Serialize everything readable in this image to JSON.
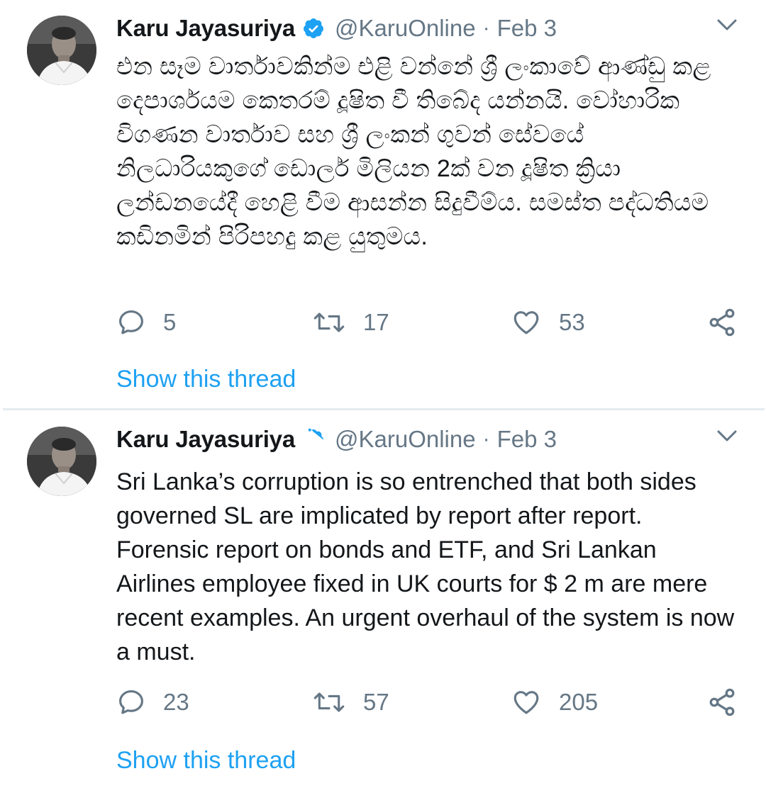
{
  "colors": {
    "accent": "#1da1f2",
    "secondary_text": "#657786",
    "primary_text": "#14171a",
    "divider": "#e6ecf0"
  },
  "tweets": [
    {
      "author_name": "Karu Jayasuriya",
      "verified_icon": "verified-badge-icon",
      "handle": "@KaruOnline",
      "separator": "·",
      "date": "Feb 3",
      "text": "එන සෑම වාර්තාවකින්ම එළි වන්නේ ශ්‍රී ලංකාවේ ආණ්ඩු කළ දෙපාර්ශයම කෙතරම් දූෂිත වී තිබේද යන්නයි. ‍වෝහාරික විගණන වාර්තාව සහ ශ්‍රී ලංකන් ගුවන් සේවයේ නිලධාරියකුගේ ඩොලර් මිලියන 2ක් වන දූෂිත ක්‍රියා ලන්ඩනයේදී හෙළි වීම ආසන්න සිදුවීම්ය. සමස්ත පද්ධතියම කඩිනමින් පිරිපහදු කළ යුතුමය.",
      "reply_count": "5",
      "retweet_count": "17",
      "like_count": "53",
      "show_thread": "Show this thread"
    },
    {
      "author_name": "Karu Jayasuriya",
      "verified_icon": "verified-badge-icon",
      "handle": "@KaruOnline",
      "separator": "·",
      "date": "Feb 3",
      "text": "Sri Lanka’s corruption is so entrenched that both sides governed SL are implicated by report after report. Forensic report on bonds and ETF, and Sri Lankan Airlines employee fixed in UK courts for $ 2 m are mere recent examples. An urgent overhaul of the system is now a must.",
      "reply_count": "23",
      "retweet_count": "57",
      "like_count": "205",
      "show_thread": "Show this thread"
    }
  ]
}
